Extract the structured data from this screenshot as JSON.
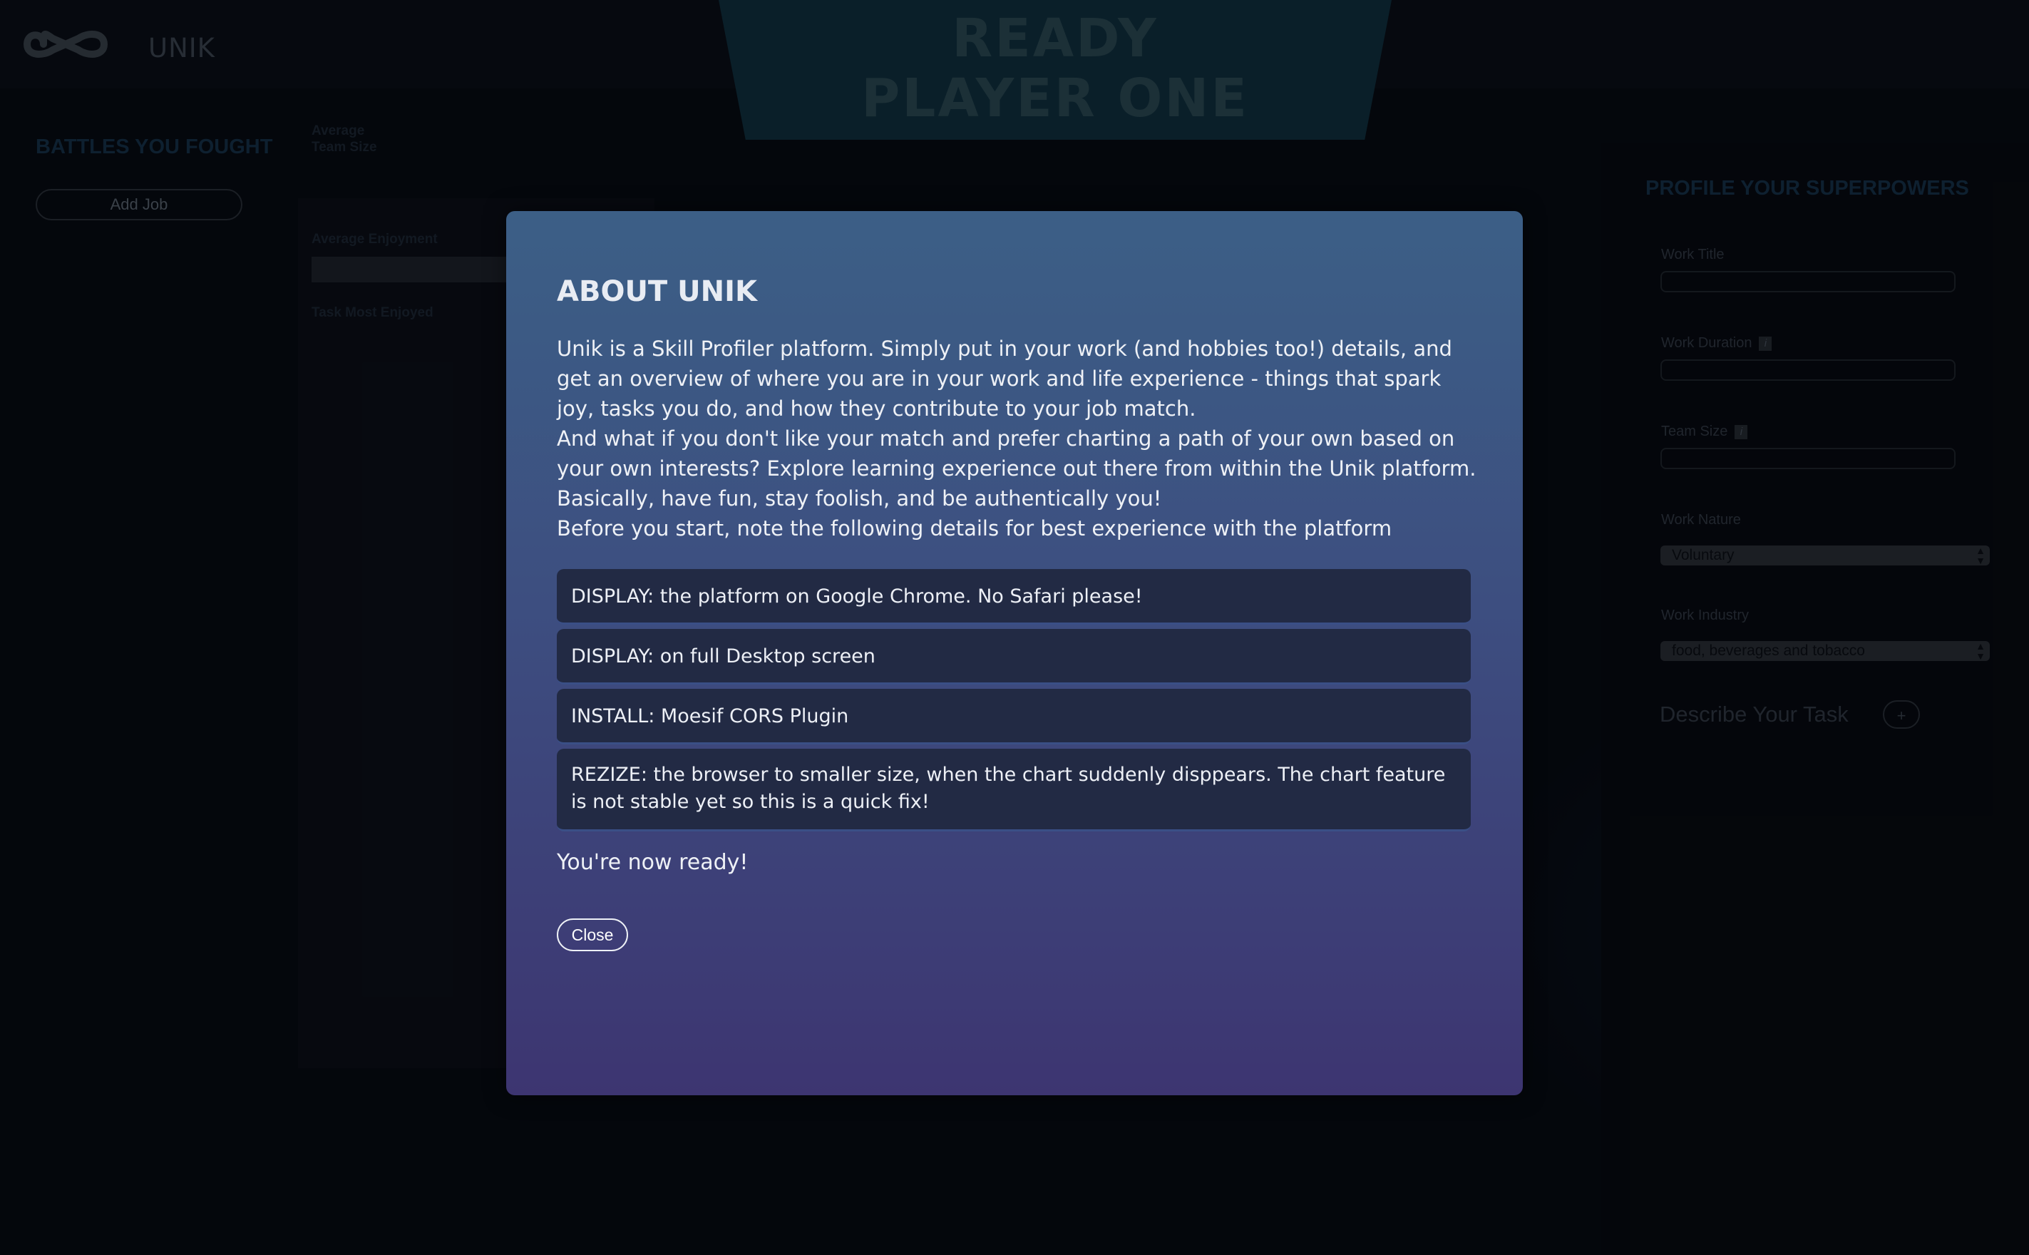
{
  "header": {
    "app_name": "UNIK",
    "banner_line1": "READY",
    "banner_line2": "PLAYER ONE"
  },
  "left": {
    "title": "BATTLES YOU FOUGHT",
    "add_job_label": "Add Job"
  },
  "middle": {
    "avg_team_size_label_line1": "Average",
    "avg_team_size_label_line2": "Team Size",
    "avg_enjoyment_label": "Average Enjoyment",
    "task_most_enjoyed_label": "Task Most Enjoyed"
  },
  "profile": {
    "title": "PROFILE YOUR SUPERPOWERS",
    "work_title_label": "Work Title",
    "work_duration_label": "Work Duration",
    "team_size_label": "Team Size",
    "info_glyph": "i",
    "work_nature_label": "Work Nature",
    "work_nature_value": "Voluntary",
    "work_industry_label": "Work Industry",
    "work_industry_value": "food, beverages and tobacco",
    "describe_task_label": "Describe Your Task",
    "add_task_label": "+"
  },
  "modal": {
    "title": "ABOUT UNIK",
    "paragraph1": "Unik is a Skill Profiler platform. Simply put in your work (and hobbies too!) details, and get an overview of where you are in your work and life experience - things that spark joy, tasks you do, and how they contribute to your job match.",
    "paragraph2": "And what if you don't like your match and prefer charting a path of your own based on your own interests? Explore learning experience out there from within the Unik platform. Basically, have fun, stay foolish, and be authentically you!",
    "paragraph3": "Before you start, note the following details for best experience with the platform",
    "notes": [
      "DISPLAY: the platform on Google Chrome. No Safari please!",
      "DISPLAY: on full Desktop screen",
      "INSTALL: Moesif CORS Plugin",
      "REZIZE: the browser to smaller size, when the chart suddenly disppears. The chart feature is not stable yet so this is a quick fix!"
    ],
    "ready_text": "You're now ready!",
    "close_label": "Close"
  },
  "colors": {
    "modal_top": "#3c5f86",
    "modal_bottom": "#3d3571",
    "note_bg": "#222a44"
  }
}
